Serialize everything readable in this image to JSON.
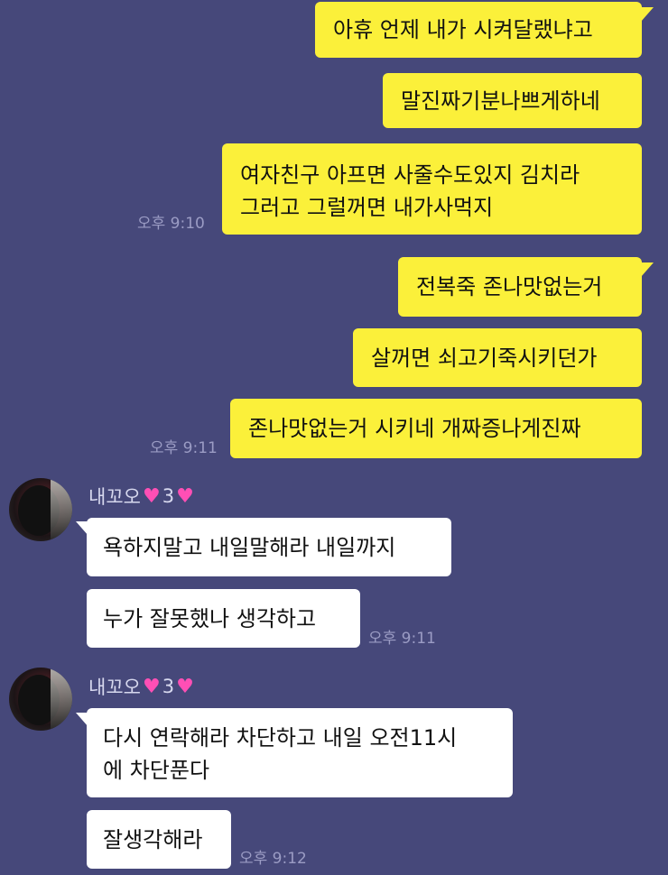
{
  "colors": {
    "background": "#46487a",
    "my_bubble": "#fbf03a",
    "their_bubble": "#ffffff",
    "timestamp": "#9b9cc4",
    "heart": "#ff4fb5"
  },
  "contact": {
    "name": "내꼬오",
    "heart_icon": "heart-icon",
    "count": "3"
  },
  "messages": {
    "m1": "아휴 언제 내가 시켜달랬냐고",
    "m2": "말진짜기분나쁘게하네",
    "m3": "여자친구 아프면 사줄수도있지 김치라\n그러고 그럴꺼면 내가사먹지",
    "m4": "전복죽 존나맛없는거",
    "m5": "살꺼면 쇠고기죽시키던가",
    "m6": "존나맛없는거 시키네 개짜증나게진짜",
    "r1": "욕하지말고 내일말해라 내일까지",
    "r2": "누가 잘못했나 생각하고",
    "r3": "다시 연락해라 차단하고 내일 오전11시\n에 차단푼다",
    "r4": "잘생각해라"
  },
  "times": {
    "t1": "오후 9:10",
    "t2": "오후 9:11",
    "t3": "오후 9:11",
    "t4": "오후 9:12"
  }
}
